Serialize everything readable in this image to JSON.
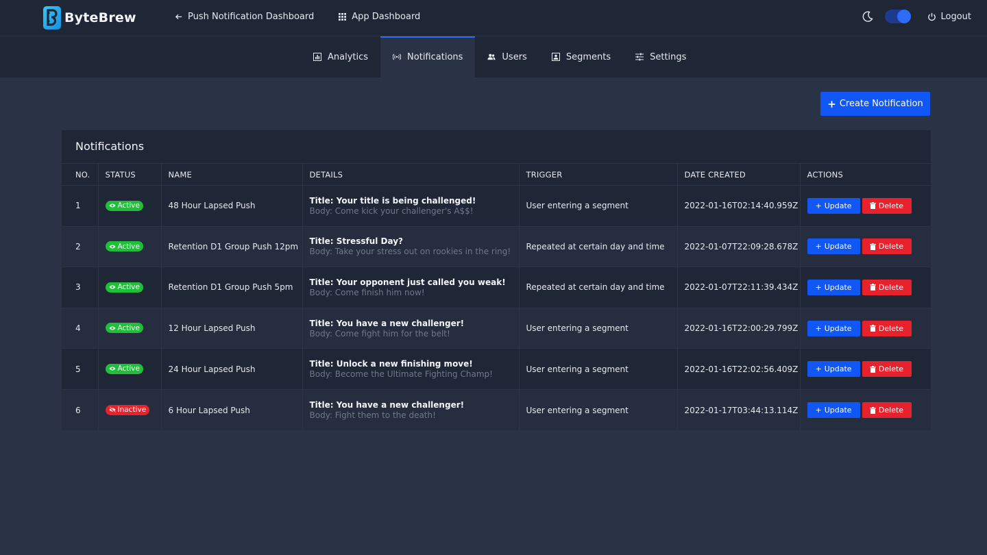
{
  "brand": {
    "name": "ByteBrew"
  },
  "topnav": {
    "back_label": "Push Notification Dashboard",
    "app_label": "App Dashboard",
    "logout_label": "Logout",
    "theme_toggle_on": true
  },
  "tabs": [
    {
      "label": "Analytics",
      "icon": "chart-icon",
      "active": false
    },
    {
      "label": "Notifications",
      "icon": "broadcast-icon",
      "active": true
    },
    {
      "label": "Users",
      "icon": "users-icon",
      "active": false
    },
    {
      "label": "Segments",
      "icon": "segments-icon",
      "active": false
    },
    {
      "label": "Settings",
      "icon": "sliders-icon",
      "active": false
    }
  ],
  "create_button": {
    "label": "Create Notification"
  },
  "card": {
    "title": "Notifications",
    "columns": [
      "NO.",
      "STATUS",
      "NAME",
      "DETAILS",
      "TRIGGER",
      "DATE CREATED",
      "ACTIONS"
    ],
    "update_label": "Update",
    "delete_label": "Delete",
    "rows": [
      {
        "no": "1",
        "status": "Active",
        "name": "48 Hour Lapsed Push",
        "title": "Title: Your title is being challenged!",
        "body": "Body: Come kick your challenger's A$$!",
        "trigger": "User entering a segment",
        "date": "2022-01-16T02:14:40.959Z"
      },
      {
        "no": "2",
        "status": "Active",
        "name": "Retention D1 Group Push 12pm",
        "title": "Title: Stressful Day?",
        "body": "Body: Take your stress out on rookies in the ring!",
        "trigger": "Repeated at certain day and time",
        "date": "2022-01-07T22:09:28.678Z"
      },
      {
        "no": "3",
        "status": "Active",
        "name": "Retention D1 Group Push 5pm",
        "title": "Title: Your opponent just called you weak!",
        "body": "Body: Come finish him now!",
        "trigger": "Repeated at certain day and time",
        "date": "2022-01-07T22:11:39.434Z"
      },
      {
        "no": "4",
        "status": "Active",
        "name": "12 Hour Lapsed Push",
        "title": "Title: You have a new challenger!",
        "body": "Body: Come fight him for the belt!",
        "trigger": "User entering a segment",
        "date": "2022-01-16T22:00:29.799Z"
      },
      {
        "no": "5",
        "status": "Active",
        "name": "24 Hour Lapsed Push",
        "title": "Title: Unlock a new finishing move!",
        "body": "Body: Become the Ultimate Fighting Champ!",
        "trigger": "User entering a segment",
        "date": "2022-01-16T22:02:56.409Z"
      },
      {
        "no": "6",
        "status": "Inactive",
        "name": "6 Hour Lapsed Push",
        "title": "Title: You have a new challenger!",
        "body": "Body: Fight them to the death!",
        "trigger": "User entering a segment",
        "date": "2022-01-17T03:44:13.114Z"
      }
    ]
  },
  "colors": {
    "accent": "#1157f5",
    "active": "#1fbf3a",
    "inactive": "#e8222d",
    "background": "#2a3345",
    "panel": "#1f2737"
  }
}
